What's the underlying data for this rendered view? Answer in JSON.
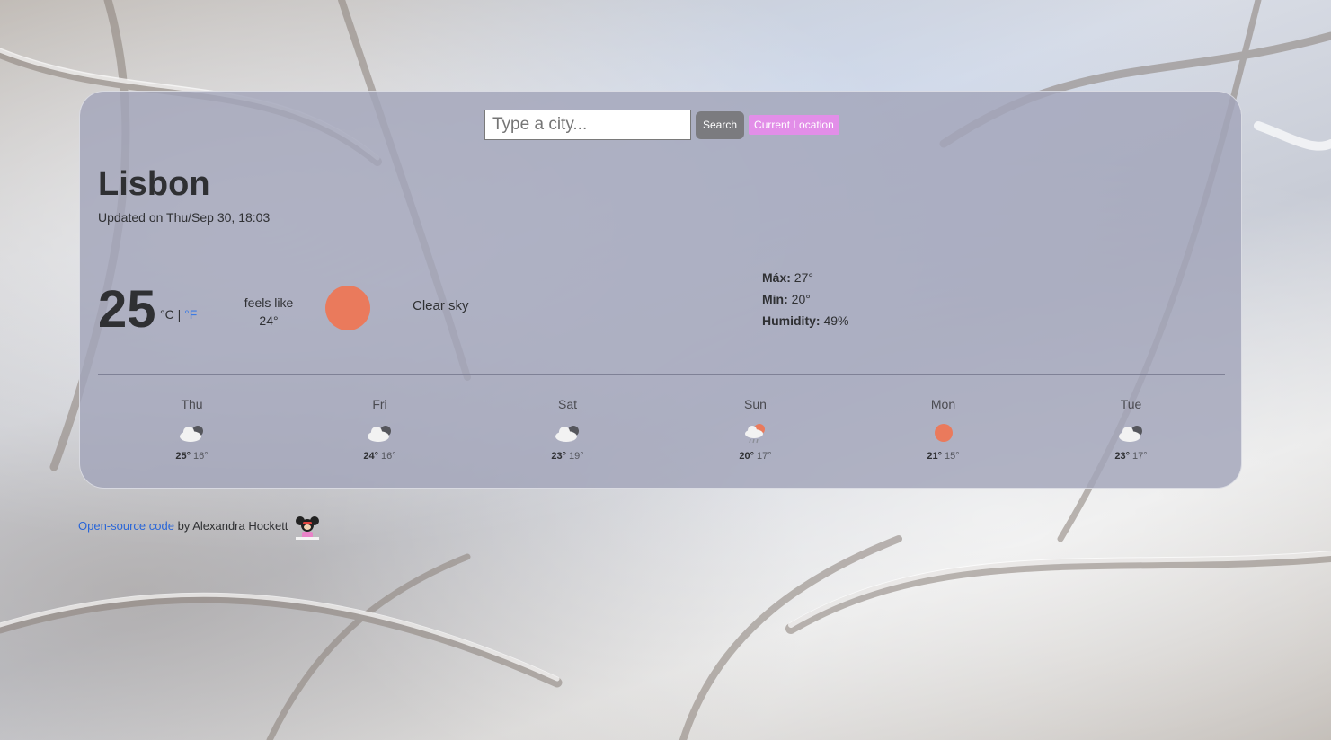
{
  "search": {
    "placeholder": "Type a city...",
    "search_label": "Search",
    "location_label": "Current Location"
  },
  "current": {
    "city": "Lisbon",
    "updated": "Updated on Thu/Sep 30, 18:03",
    "temperature": "25",
    "unit_celsius": "°C",
    "unit_separator": "|",
    "unit_fahrenheit": "°F",
    "feels_like_label": "feels like",
    "feels_like_value": "24°",
    "icon": "sun-icon",
    "description": "Clear sky",
    "max_label": "Máx:",
    "max_value": "27°",
    "min_label": "Min:",
    "min_value": "20°",
    "humidity_label": "Humidity:",
    "humidity_value": "49%"
  },
  "forecast": [
    {
      "day": "Thu",
      "icon": "cloudy-icon",
      "max": "25°",
      "min": "16°"
    },
    {
      "day": "Fri",
      "icon": "cloudy-icon",
      "max": "24°",
      "min": "16°"
    },
    {
      "day": "Sat",
      "icon": "cloudy-icon",
      "max": "23°",
      "min": "19°"
    },
    {
      "day": "Sun",
      "icon": "rain-sun-icon",
      "max": "20°",
      "min": "17°"
    },
    {
      "day": "Mon",
      "icon": "sun-icon",
      "max": "21°",
      "min": "15°"
    },
    {
      "day": "Tue",
      "icon": "cloudy-icon",
      "max": "23°",
      "min": "17°"
    }
  ],
  "footer": {
    "link_text": "Open-source code",
    "author_text": " by Alexandra Hockett"
  },
  "colors": {
    "sun": "#ea7a5c",
    "link": "#2a66d8",
    "location_button": "#e28ee8",
    "search_button": "#7b7b7f"
  }
}
